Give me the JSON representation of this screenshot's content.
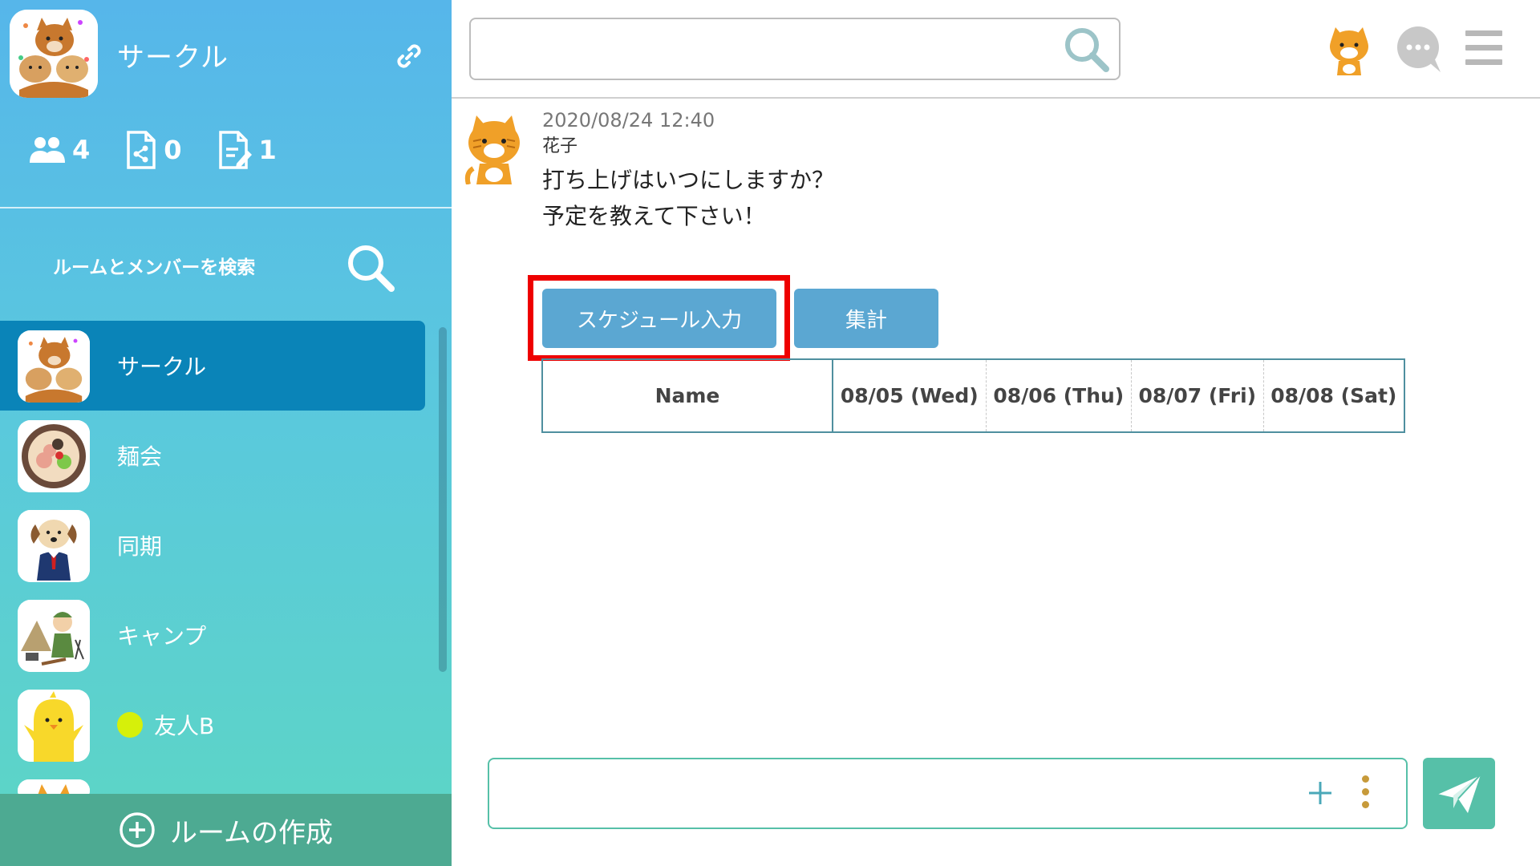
{
  "sidebar": {
    "circle_title": "サークル",
    "stats": {
      "members": "4",
      "files": "0",
      "notes": "1"
    },
    "search_label": "ルームとメンバーを検索",
    "rooms": [
      {
        "name": "サークル",
        "selected": true
      },
      {
        "name": "麺会"
      },
      {
        "name": "同期"
      },
      {
        "name": "キャンプ"
      },
      {
        "name": "友人B",
        "status_dot": "#d6f00a"
      }
    ],
    "create_room_label": "ルームの作成"
  },
  "topbar": {
    "search_placeholder": ""
  },
  "message": {
    "timestamp": "2020/08/24 12:40",
    "sender": "花子",
    "lines": [
      "打ち上げはいつにしますか？",
      "予定を教えて下さい！"
    ],
    "buttons": {
      "schedule": "スケジュール入力",
      "sum": "集計"
    },
    "table": {
      "headers": [
        "Name",
        "08/05 (Wed)",
        "08/06 (Thu)",
        "08/07 (Fri)",
        "08/08 (Sat)"
      ]
    }
  },
  "composer": {
    "placeholder": ""
  },
  "colors": {
    "selected_room": "#0a84b8",
    "button": "#5ba7d2",
    "accent_green": "#56c0a8",
    "highlight": "#ee0000"
  }
}
